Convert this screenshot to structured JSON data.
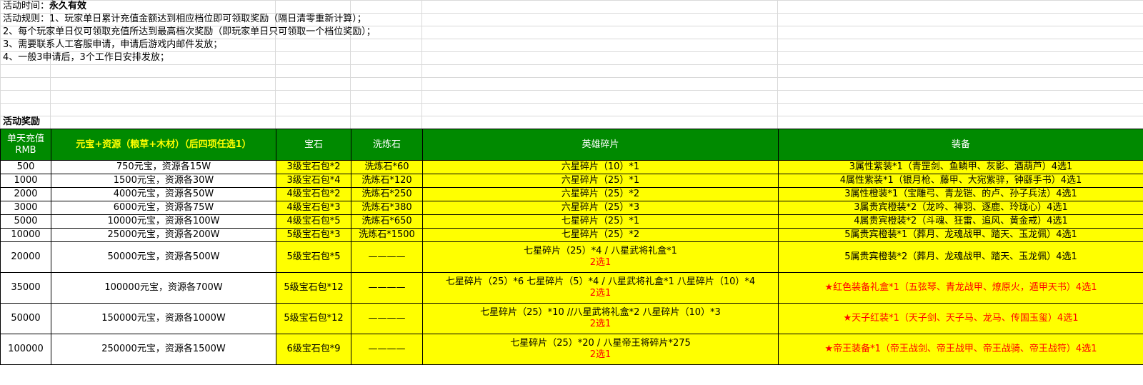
{
  "intro": {
    "time_label": "活动时间：",
    "time_value": "永久有效",
    "rule1": "活动规则：1、玩家单日累计充值金额达到相应档位即可领取奖励（隔日清零重新计算）；",
    "rule2": "2、每个玩家单日仅可领取充值所达到最高档次奖励（即玩家单日只可领取一个档位奖励）；",
    "rule3": "3、需要联系人工客服申请，申请后游戏内邮件发放；",
    "rule4": "4、一般3申请后，3个工作日安排发放；",
    "section_title": "活动奖励"
  },
  "table": {
    "headers": {
      "rmb_line1": "单天充值",
      "rmb_line2": "RMB",
      "currency": "元宝+资源（粮草+木材）（后四项任选1）",
      "gem": "宝石",
      "refine": "洗炼石",
      "hero": "英雄碎片",
      "equip": "装备"
    },
    "rows": [
      {
        "rmb": "500",
        "currency": "750元宝，资源各15W",
        "gem": "3级宝石包*2",
        "refine": "洗炼石*60",
        "hero": "六星碎片（10）*1",
        "hero_note": "",
        "equip": "3属性紫装*1（青罡剑、鱼鳞甲、灰影、酒葫芦）4选1"
      },
      {
        "rmb": "1000",
        "currency": "1500元宝，资源各30W",
        "gem": "3级宝石包*4",
        "refine": "洗炼石*120",
        "hero": "六星碎片（25）*1",
        "hero_note": "",
        "equip": "4属性紫装*1（银月枪、藤甲、大宛紫骍，钟繇手书）4选1"
      },
      {
        "rmb": "2000",
        "currency": "4000元宝，资源各50W",
        "gem": "4级宝石包*2",
        "refine": "洗炼石*250",
        "hero": "六星碎片（25）*2",
        "hero_note": "",
        "equip": "3属性橙装*1（宝雕弓、青龙铠、的卢、孙子兵法）4选1"
      },
      {
        "rmb": "3000",
        "currency": "6000元宝，资源各75W",
        "gem": "4级宝石包*3",
        "refine": "洗炼石*380",
        "hero": "六星碎片（25）*3",
        "hero_note": "",
        "equip": "3属贵宾橙装*2（龙吟、神羽、逐鹿、玲珑心）4选1"
      },
      {
        "rmb": "5000",
        "currency": "10000元宝，资源各100W",
        "gem": "4级宝石包*5",
        "refine": "洗炼石*650",
        "hero": "七星碎片（25）*1",
        "hero_note": "",
        "equip": "4属贵宾橙装*2（斗魂、狂雷、追风、黄金戒）4选1"
      },
      {
        "rmb": "10000",
        "currency": "25000元宝，资源各200W",
        "gem": "5级宝石包*3",
        "refine": "洗炼石*1500",
        "hero": "七星碎片（25）*2",
        "hero_note": "",
        "equip": "5属贵宾橙装*1（葬月、龙魂战甲、踏天、玉龙佩）4选1"
      },
      {
        "rmb": "20000",
        "currency": "50000元宝，资源各500W",
        "gem": "5级宝石包*5",
        "refine": "————",
        "hero": "七星碎片（25）*4 / 八星武将礼盒*1",
        "hero_note": "2选1",
        "equip": "5属贵宾橙装*2（葬月、龙魂战甲、踏天、玉龙佩）4选1"
      },
      {
        "rmb": "35000",
        "currency": "100000元宝，资源各700W",
        "gem": "5级宝石包*12",
        "refine": "————",
        "hero": "七星碎片（25）*6 七星碎片（5）*4 / 八星武将礼盒*1 八星碎片（10）*4",
        "hero_note": "2选1",
        "equip_star": "★",
        "equip": "红色装备礼盒*1（五弦琴、青龙战甲、燎原火，遁甲天书）4选1"
      },
      {
        "rmb": "50000",
        "currency": "150000元宝，资源各1000W",
        "gem": "5级宝石包*12",
        "refine": "————",
        "hero": "七星碎片（25）*10 //八星武将礼盒*2 八星碎片（10）*3",
        "hero_note": "2选1",
        "equip_star": "★",
        "equip": "天子红装*1（天子剑、天子马、龙马、传国玉玺）4选1"
      },
      {
        "rmb": "100000",
        "currency": "250000元宝，资源各1500W",
        "gem": "6级宝石包*9",
        "refine": "————",
        "hero": "七星碎片（25）*20 / 八星帝王将碎片*275",
        "hero_note": "2选1",
        "equip_star": "★",
        "equip": "帝王装备*1（帝王战剑、帝王战甲、帝王战骑、帝王战符）4选1"
      }
    ]
  }
}
